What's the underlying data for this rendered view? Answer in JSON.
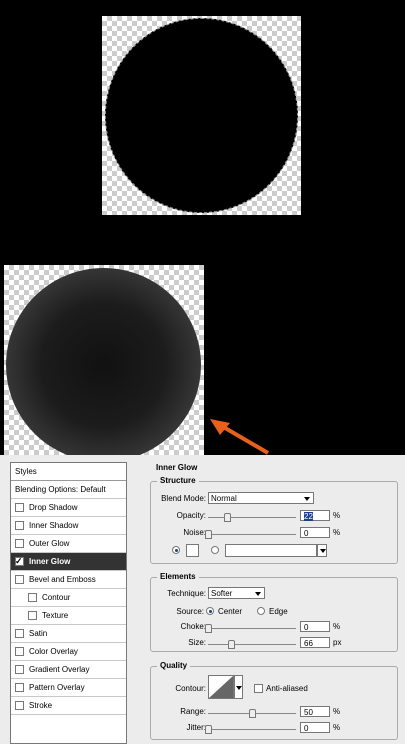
{
  "styles_list": {
    "header": "Styles",
    "items": [
      {
        "label": "Blending Options: Default",
        "checkbox": false,
        "indent": false,
        "checked": false,
        "active": false
      },
      {
        "label": "Drop Shadow",
        "checkbox": true,
        "indent": false,
        "checked": false,
        "active": false
      },
      {
        "label": "Inner Shadow",
        "checkbox": true,
        "indent": false,
        "checked": false,
        "active": false
      },
      {
        "label": "Outer Glow",
        "checkbox": true,
        "indent": false,
        "checked": false,
        "active": false
      },
      {
        "label": "Inner Glow",
        "checkbox": true,
        "indent": false,
        "checked": true,
        "active": true
      },
      {
        "label": "Bevel and Emboss",
        "checkbox": true,
        "indent": false,
        "checked": false,
        "active": false
      },
      {
        "label": "Contour",
        "checkbox": true,
        "indent": true,
        "checked": false,
        "active": false
      },
      {
        "label": "Texture",
        "checkbox": true,
        "indent": true,
        "checked": false,
        "active": false
      },
      {
        "label": "Satin",
        "checkbox": true,
        "indent": false,
        "checked": false,
        "active": false
      },
      {
        "label": "Color Overlay",
        "checkbox": true,
        "indent": false,
        "checked": false,
        "active": false
      },
      {
        "label": "Gradient Overlay",
        "checkbox": true,
        "indent": false,
        "checked": false,
        "active": false
      },
      {
        "label": "Pattern Overlay",
        "checkbox": true,
        "indent": false,
        "checked": false,
        "active": false
      },
      {
        "label": "Stroke",
        "checkbox": true,
        "indent": false,
        "checked": false,
        "active": false
      }
    ]
  },
  "panel": {
    "title": "Inner Glow",
    "structure": {
      "title": "Structure",
      "blend_mode_label": "Blend Mode:",
      "blend_mode_value": "Normal",
      "opacity_label": "Opacity:",
      "opacity_value": "22",
      "opacity_level": 0.22,
      "noise_label": "Noise:",
      "noise_value": "0",
      "noise_level": 0,
      "unit": "%"
    },
    "elements": {
      "title": "Elements",
      "technique_label": "Technique:",
      "technique_value": "Softer",
      "source_label": "Source:",
      "source_center": "Center",
      "source_edge": "Edge",
      "choke_label": "Choke:",
      "choke_value": "0",
      "choke_level": 0,
      "choke_unit": "%",
      "size_label": "Size:",
      "size_value": "66",
      "size_level": 0.26,
      "size_unit": "px"
    },
    "quality": {
      "title": "Quality",
      "contour_label": "Contour:",
      "anti_aliased_label": "Anti-aliased",
      "range_label": "Range:",
      "range_value": "50",
      "range_level": 0.5,
      "jitter_label": "Jitter:",
      "jitter_value": "0",
      "jitter_level": 0,
      "unit": "%"
    }
  },
  "colors": {
    "accent_arrow": "#e8601c",
    "active_row": "#333333",
    "panel_bg": "#ececec"
  }
}
